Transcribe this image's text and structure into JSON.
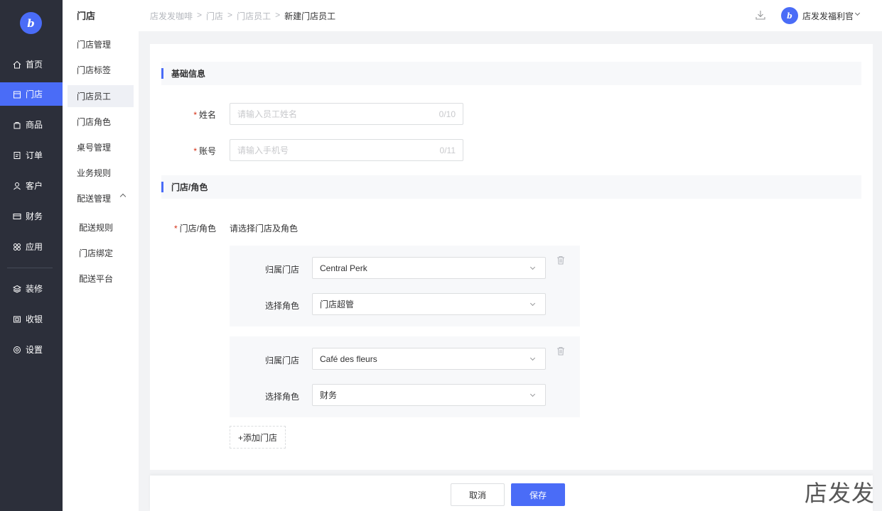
{
  "nav": {
    "items": [
      {
        "label": "首页",
        "icon": "home-icon"
      },
      {
        "label": "门店",
        "icon": "store-icon"
      },
      {
        "label": "商品",
        "icon": "bag-icon"
      },
      {
        "label": "订单",
        "icon": "order-icon"
      },
      {
        "label": "客户",
        "icon": "user-icon"
      },
      {
        "label": "财务",
        "icon": "card-icon"
      },
      {
        "label": "应用",
        "icon": "apps-icon"
      },
      {
        "label": "装修",
        "icon": "layers-icon"
      },
      {
        "label": "收银",
        "icon": "cashier-icon"
      },
      {
        "label": "设置",
        "icon": "settings-icon"
      }
    ],
    "active_color": "#4a6cf7"
  },
  "sub": {
    "title": "门店",
    "items": [
      "门店管理",
      "门店标签",
      "门店员工",
      "门店角色",
      "桌号管理",
      "业务规则",
      "配送管理"
    ],
    "children": [
      "配送规则",
      "门店绑定",
      "配送平台"
    ]
  },
  "header": {
    "crumbs": [
      "店发发咖啡",
      "门店",
      "门店员工",
      "新建门店员工"
    ],
    "user_name": "店发发福利官"
  },
  "form": {
    "section_basic": "基础信息",
    "name_label": "姓名",
    "name_placeholder": "请输入员工姓名",
    "name_count": "0/10",
    "account_label": "账号",
    "account_placeholder": "请输入手机号",
    "account_count": "0/11",
    "section_store": "门店/角色",
    "store_role_label": "门店/角色",
    "store_role_hint": "请选择门店及角色",
    "groups": [
      {
        "store_label": "归属门店",
        "store_value": "Central Perk",
        "role_label": "选择角色",
        "role_value": "门店超管"
      },
      {
        "store_label": "归属门店",
        "store_value": "Café des fleurs",
        "role_label": "选择角色",
        "role_value": "财务"
      }
    ],
    "add_store": "+添加门店"
  },
  "footer": {
    "cancel": "取消",
    "save": "保存"
  },
  "watermark": "店发发"
}
